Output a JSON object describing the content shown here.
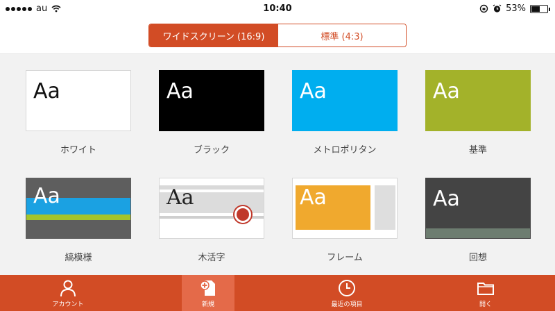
{
  "status": {
    "carrier": "au",
    "time": "10:40",
    "battery": "53%",
    "battery_level": 0.53
  },
  "orientation": {
    "widescreen_label": "ワイドスクリーン (16:9)",
    "standard_label": "標準 (4:3)",
    "selected": "widescreen"
  },
  "templates": [
    {
      "name": "ホワイト",
      "sample": "Aa"
    },
    {
      "name": "ブラック",
      "sample": "Aa"
    },
    {
      "name": "メトロポリタン",
      "sample": "Aa"
    },
    {
      "name": "基準",
      "sample": "Aa"
    },
    {
      "name": "縞模様",
      "sample": "Aa"
    },
    {
      "name": "木活字",
      "sample": "Aa"
    },
    {
      "name": "フレーム",
      "sample": "Aa"
    },
    {
      "name": "回想",
      "sample": "Aa"
    }
  ],
  "toolbar": {
    "account": "アカウント",
    "new": "新規",
    "recent": "最近の項目",
    "open": "開く"
  },
  "colors": {
    "accent": "#d24c25",
    "active_tab": "#e46a49"
  }
}
